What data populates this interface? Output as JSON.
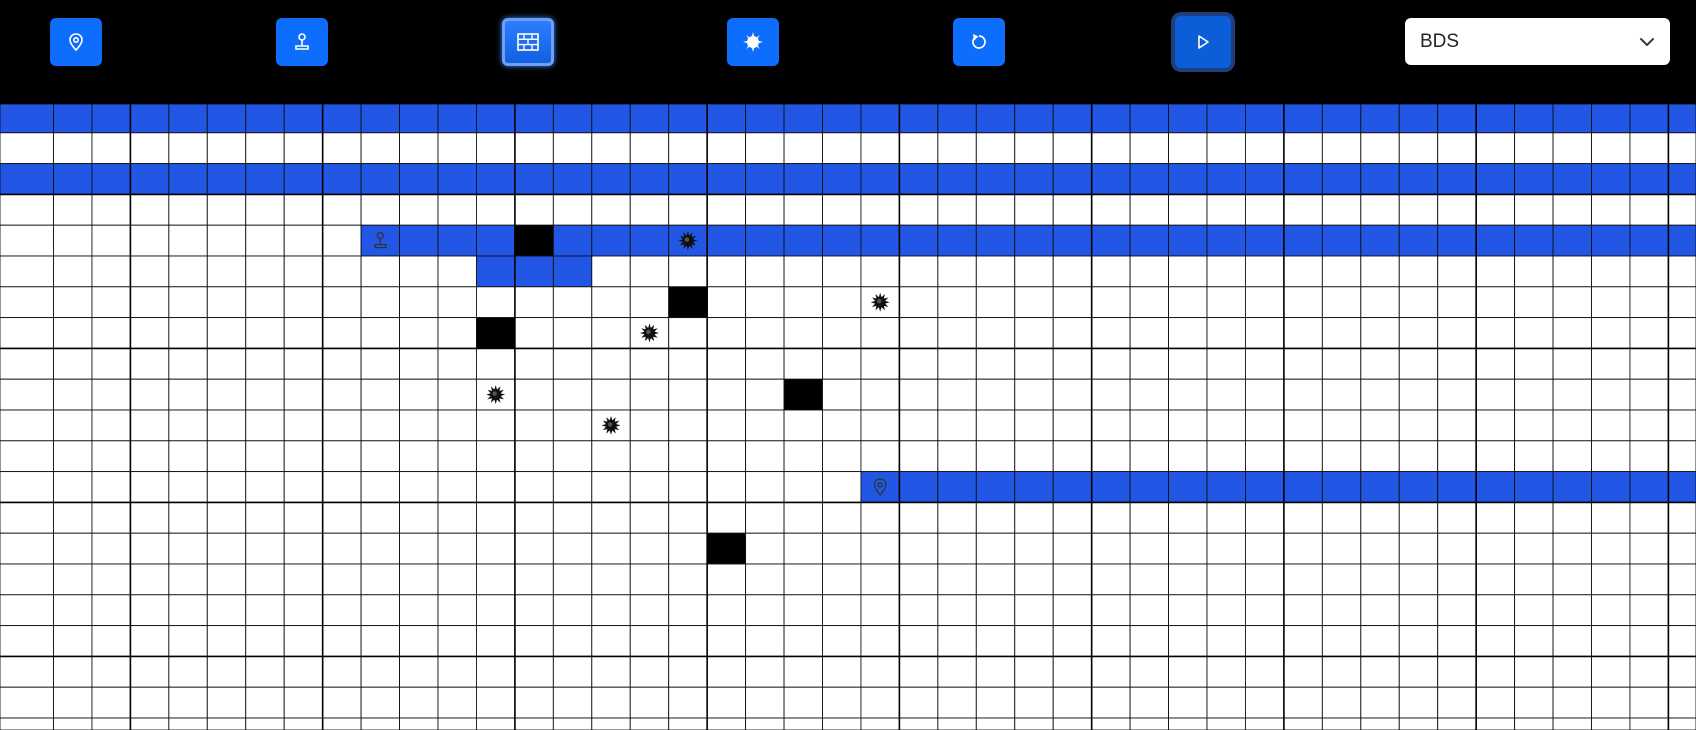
{
  "toolbar": {
    "buttons": [
      {
        "name": "place-target-button",
        "icon": "map-pin-icon",
        "state": "normal"
      },
      {
        "name": "place-start-button",
        "icon": "joystick-icon",
        "state": "normal"
      },
      {
        "name": "draw-wall-button",
        "icon": "brick-wall-icon",
        "state": "active"
      },
      {
        "name": "place-bomb-button",
        "icon": "bomb-icon",
        "state": "normal"
      },
      {
        "name": "reset-button",
        "icon": "reset-icon",
        "state": "normal"
      },
      {
        "name": "run-button",
        "icon": "play-icon",
        "state": "focused"
      }
    ],
    "algorithm_select": {
      "value": "BDS"
    }
  },
  "colors": {
    "accent": "#0d6efd",
    "visited": "#2257e6",
    "wall": "#000000",
    "empty": "#ffffff"
  },
  "grid": {
    "rows": 21,
    "cols": 44,
    "first_row_partial": true,
    "visited": [
      {
        "row": 0,
        "col_start": 0,
        "col_end": 43
      },
      {
        "row": 2,
        "col_start": 0,
        "col_end": 43
      },
      {
        "row": 4,
        "col_start": 9,
        "col_end": 43
      },
      {
        "row": 5,
        "col_start": 12,
        "col_end": 14
      },
      {
        "row": 12,
        "col_start": 22,
        "col_end": 43
      }
    ],
    "walls": [
      {
        "row": 4,
        "col": 13
      },
      {
        "row": 6,
        "col": 17
      },
      {
        "row": 7,
        "col": 12
      },
      {
        "row": 9,
        "col": 20
      },
      {
        "row": 14,
        "col": 18
      }
    ],
    "bombs": [
      {
        "row": 4,
        "col": 17
      },
      {
        "row": 6,
        "col": 22
      },
      {
        "row": 7,
        "col": 16
      },
      {
        "row": 9,
        "col": 12
      },
      {
        "row": 10,
        "col": 15
      }
    ],
    "start": {
      "row": 4,
      "col": 9,
      "icon": "joystick-icon"
    },
    "target": {
      "row": 12,
      "col": 22,
      "icon": "map-pin-icon"
    }
  }
}
